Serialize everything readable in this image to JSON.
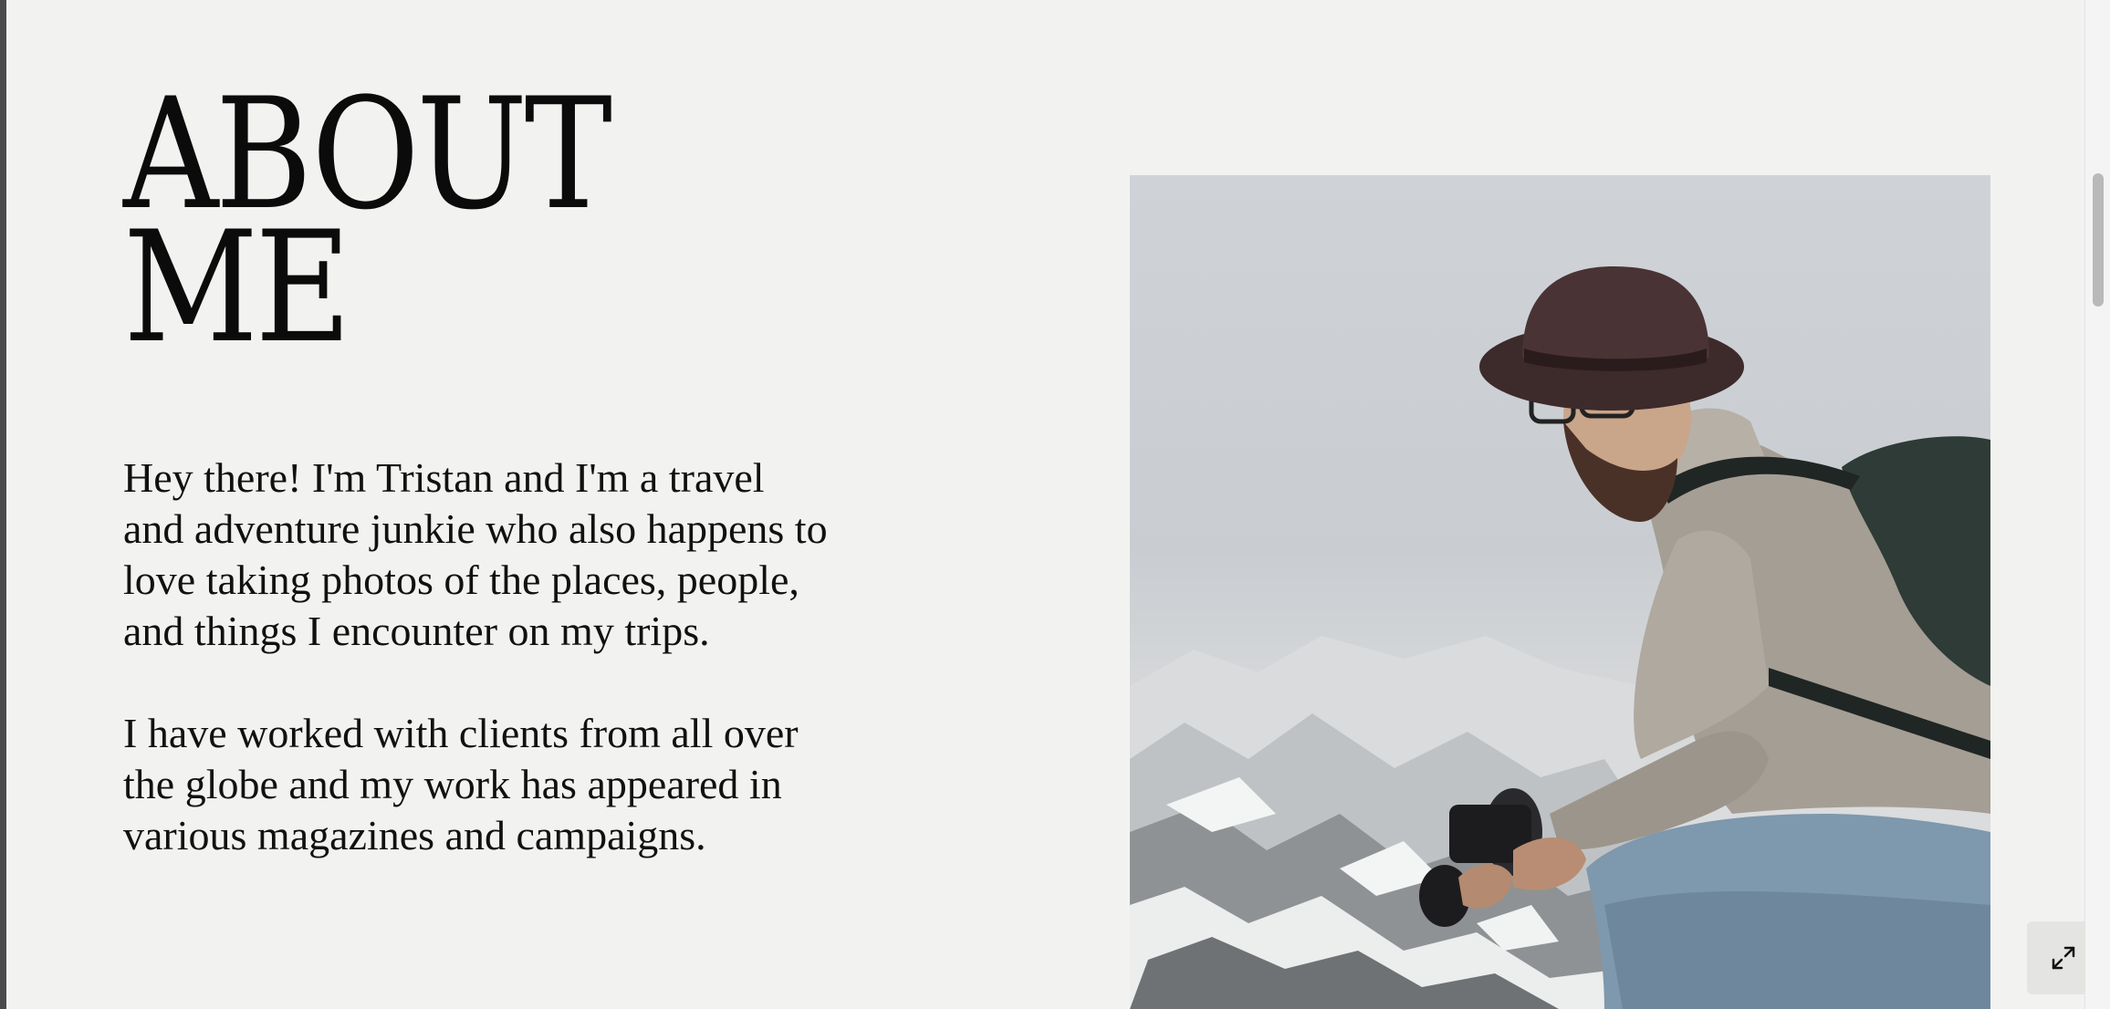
{
  "heading": {
    "line1": "ABOUT",
    "line2": "ME"
  },
  "bio": {
    "paragraph1": "Hey there! I'm Tristan and I'm a travel and adventure junkie who also happens to love taking photos of the places, people, and things I encounter on my trips.",
    "paragraph2": "I have worked with clients from all over the globe and my work has appeared in various magazines and campaigns."
  },
  "photo": {
    "subject": "man in hat with camera on snowy mountain"
  },
  "controls": {
    "expand_icon": "expand-icon"
  },
  "colors": {
    "background": "#f2f2f0",
    "text": "#0b0b0b"
  }
}
